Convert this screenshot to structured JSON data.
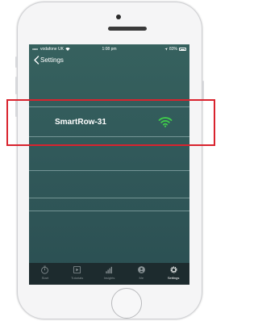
{
  "status_bar": {
    "carrier": "vodafone UK",
    "time": "1:08 pm",
    "battery_percent": "83%",
    "battery_level": 0.83
  },
  "nav": {
    "back_label": "Settings"
  },
  "device": {
    "name": "SmartRow-31",
    "signal_icon": "wifi-icon",
    "signal_color": "#3fcf4a"
  },
  "tabs": [
    {
      "label": "Start",
      "icon": "timer-icon",
      "active": false
    },
    {
      "label": "Tutorials",
      "icon": "video-icon",
      "active": false
    },
    {
      "label": "Insights",
      "icon": "bar-chart-icon",
      "active": false
    },
    {
      "label": "Me",
      "icon": "person-icon",
      "active": false
    },
    {
      "label": "Settings",
      "icon": "gear-icon",
      "active": true
    }
  ],
  "colors": {
    "screen_bg": "#31595a",
    "tab_bar_bg": "#1d2b2e",
    "highlight": "#d9232e"
  }
}
